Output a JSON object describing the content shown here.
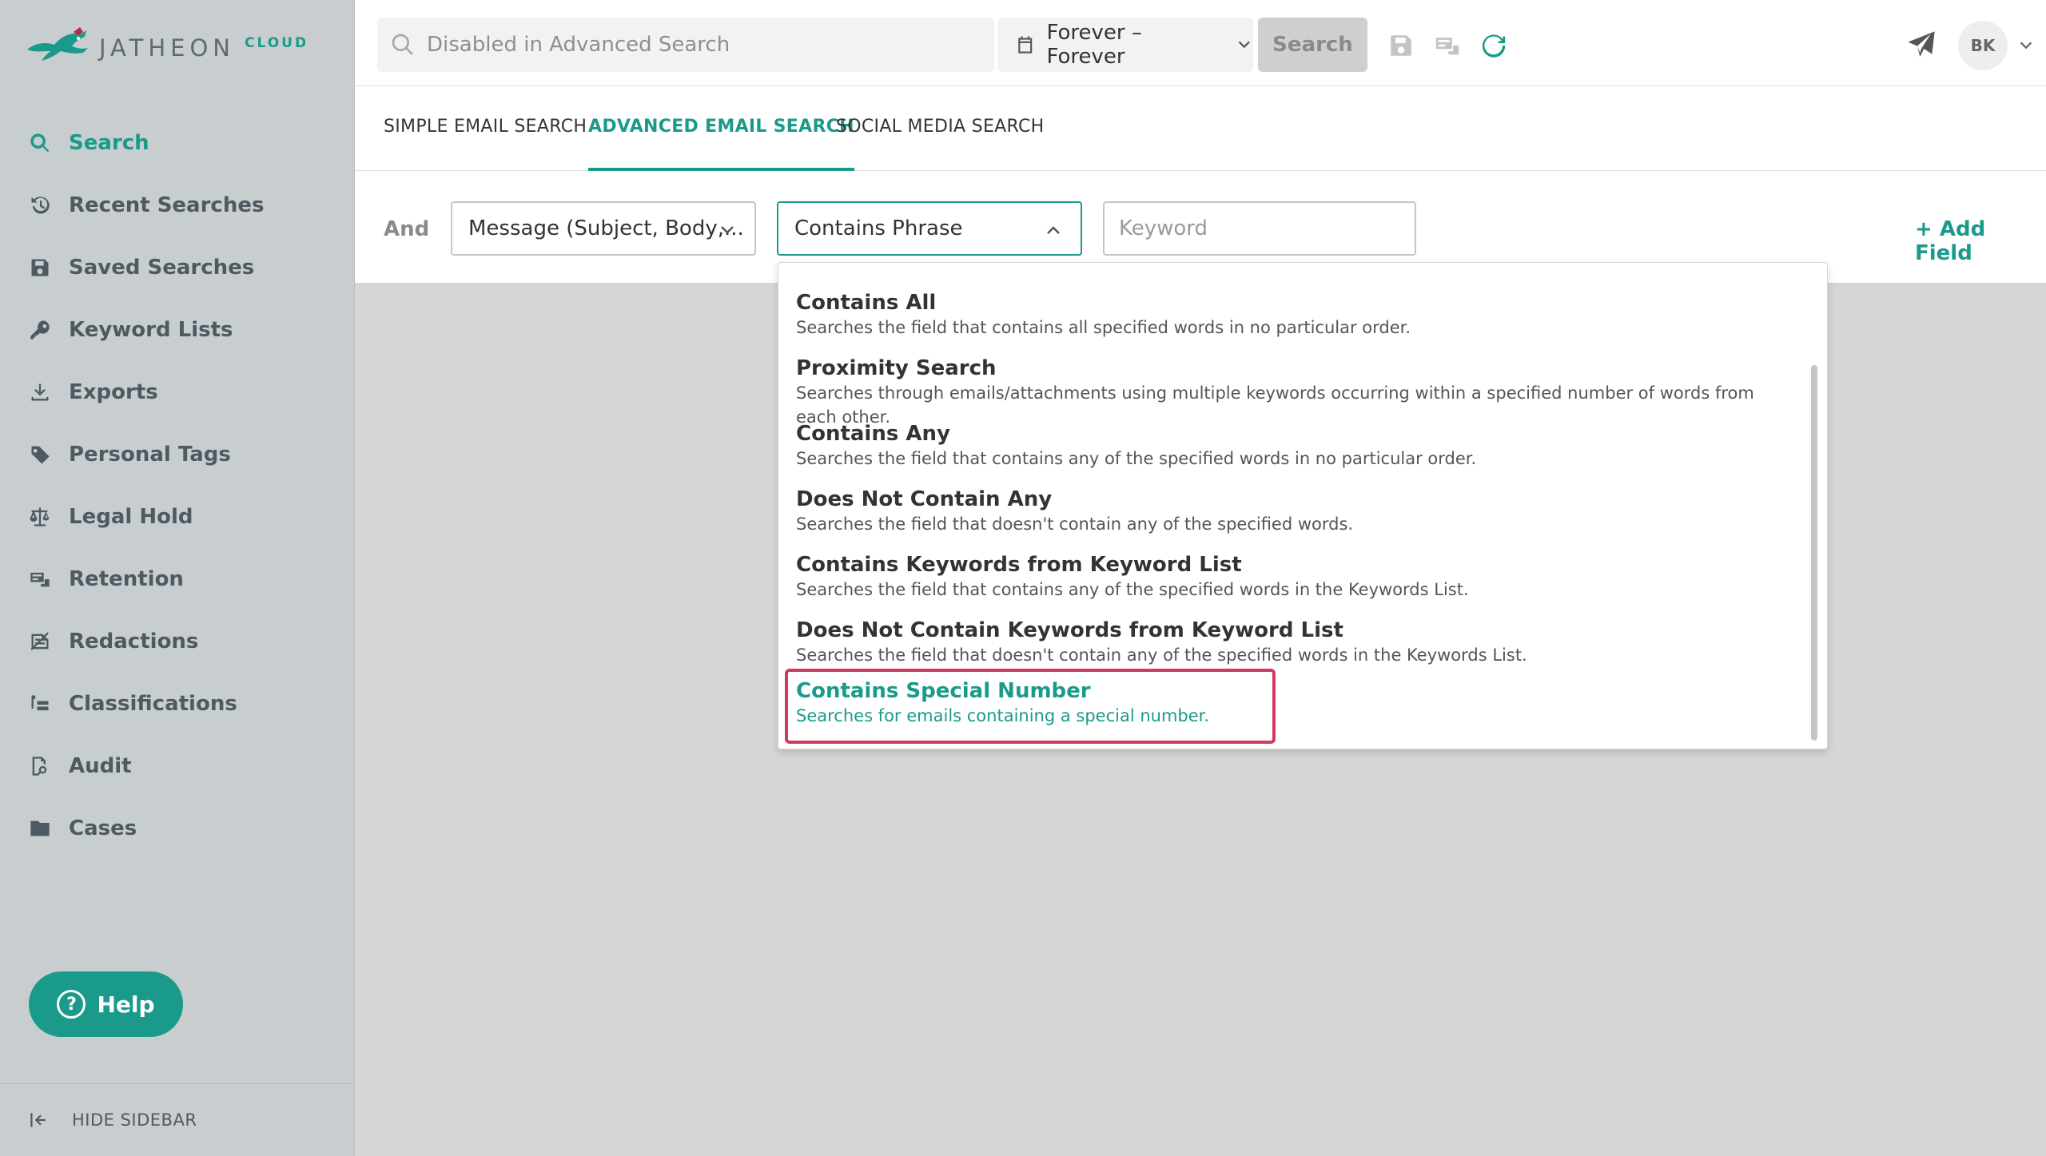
{
  "brand": {
    "name": "JATHEON",
    "suffix": "CLOUD",
    "accent_color": "#1a9a8a",
    "highlight_color": "#d03a5e"
  },
  "sidebar": {
    "items": [
      {
        "label": "Search",
        "icon": "search-icon",
        "active": true
      },
      {
        "label": "Recent Searches",
        "icon": "history-icon"
      },
      {
        "label": "Saved Searches",
        "icon": "save-icon"
      },
      {
        "label": "Keyword Lists",
        "icon": "key-icon"
      },
      {
        "label": "Exports",
        "icon": "download-icon"
      },
      {
        "label": "Personal Tags",
        "icon": "tag-icon"
      },
      {
        "label": "Legal Hold",
        "icon": "scale-icon"
      },
      {
        "label": "Retention",
        "icon": "retention-icon"
      },
      {
        "label": "Redactions",
        "icon": "redaction-icon"
      },
      {
        "label": "Classifications",
        "icon": "hierarchy-icon"
      },
      {
        "label": "Audit",
        "icon": "audit-icon"
      },
      {
        "label": "Cases",
        "icon": "folder-icon"
      }
    ],
    "help_label": "Help",
    "hide_label": "HIDE SIDEBAR"
  },
  "topbar": {
    "search_placeholder": "Disabled in Advanced Search",
    "date_range": "Forever – Forever",
    "search_button": "Search",
    "user_initials": "BK"
  },
  "tabs": [
    {
      "label": "SIMPLE EMAIL SEARCH"
    },
    {
      "label": "ADVANCED EMAIL SEARCH",
      "active": true
    },
    {
      "label": "SOCIAL MEDIA SEARCH"
    }
  ],
  "field_row": {
    "operator": "And",
    "field_select": "Message (Subject, Body,...",
    "condition_select": "Contains Phrase",
    "keyword_placeholder": "Keyword",
    "add_field": "+ Add Field"
  },
  "dropdown": {
    "options": [
      {
        "title": "Contains All",
        "desc": "Searches the field that contains all specified words in no particular order."
      },
      {
        "title": "Proximity Search",
        "desc": "Searches through emails/attachments using multiple keywords occurring within a specified number of words from each other."
      },
      {
        "title": "Contains Any",
        "desc": "Searches the field that contains any of the specified words in no particular order."
      },
      {
        "title": "Does Not Contain Any",
        "desc": "Searches the field that doesn't contain any of the specified words."
      },
      {
        "title": "Contains Keywords from Keyword List",
        "desc": "Searches the field that contains any of the specified words in the Keywords List."
      },
      {
        "title": "Does Not Contain Keywords from Keyword List",
        "desc": "Searches the field that doesn't contain any of the specified words in the Keywords List."
      },
      {
        "title": "Contains Special Number",
        "desc": "Searches for emails containing a special number.",
        "highlighted": true
      }
    ]
  }
}
